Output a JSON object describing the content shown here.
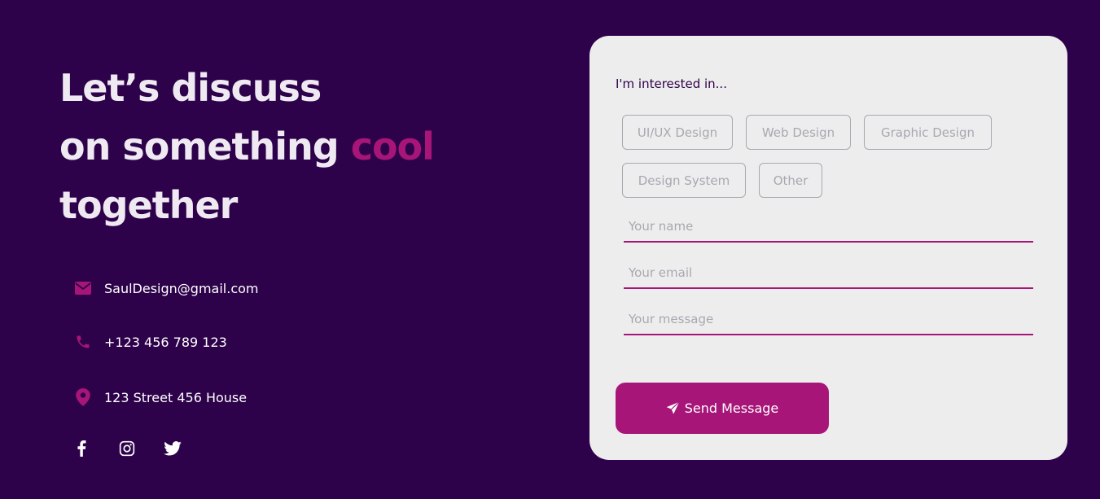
{
  "headline": {
    "line1": "Let’s discuss",
    "line2_prefix": "on something ",
    "line2_accent": "cool",
    "line3": "together"
  },
  "contact": {
    "email": "SaulDesign@gmail.com",
    "phone": "+123 456 789 123",
    "address": "123 Street 456 House"
  },
  "socials": [
    "facebook-icon",
    "instagram-icon",
    "twitter-icon"
  ],
  "form": {
    "interest_label": "I'm interested in...",
    "chips": [
      "UI/UX Design",
      "Web Design",
      "Graphic Design",
      "Design System",
      "Other"
    ],
    "name_placeholder": "Your name",
    "email_placeholder": "Your email",
    "message_placeholder": "Your message",
    "submit_label": "Send Message"
  },
  "colors": {
    "background": "#2d024a",
    "accent": "#a61577",
    "card": "#eeedee",
    "muted": "#a9a7b0"
  }
}
